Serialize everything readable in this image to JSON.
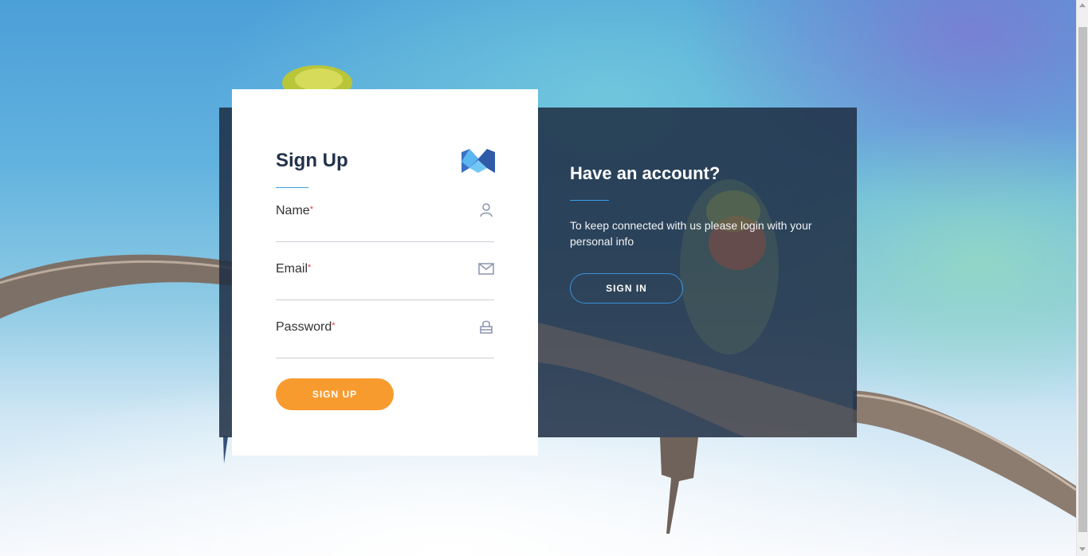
{
  "signup": {
    "title": "Sign Up",
    "logo_icon": "stacked-blue-m-logo",
    "fields": [
      {
        "label": "Name",
        "required_mark": "*",
        "icon": "user-icon",
        "value": ""
      },
      {
        "label": "Email",
        "required_mark": "*",
        "icon": "envelope-icon",
        "value": ""
      },
      {
        "label": "Password",
        "required_mark": "*",
        "icon": "lock-icon",
        "value": ""
      }
    ],
    "submit_label": "SIGN UP"
  },
  "signin": {
    "title": "Have an account?",
    "text": "To keep connected with us please login with your personal info",
    "button_label": "SIGN IN"
  },
  "colors": {
    "accent_orange": "#f89b2f",
    "accent_blue": "#3aa0e6",
    "panel_dark": "#1e2d44",
    "title_text": "#22324a",
    "required_mark": "#e2374b"
  }
}
